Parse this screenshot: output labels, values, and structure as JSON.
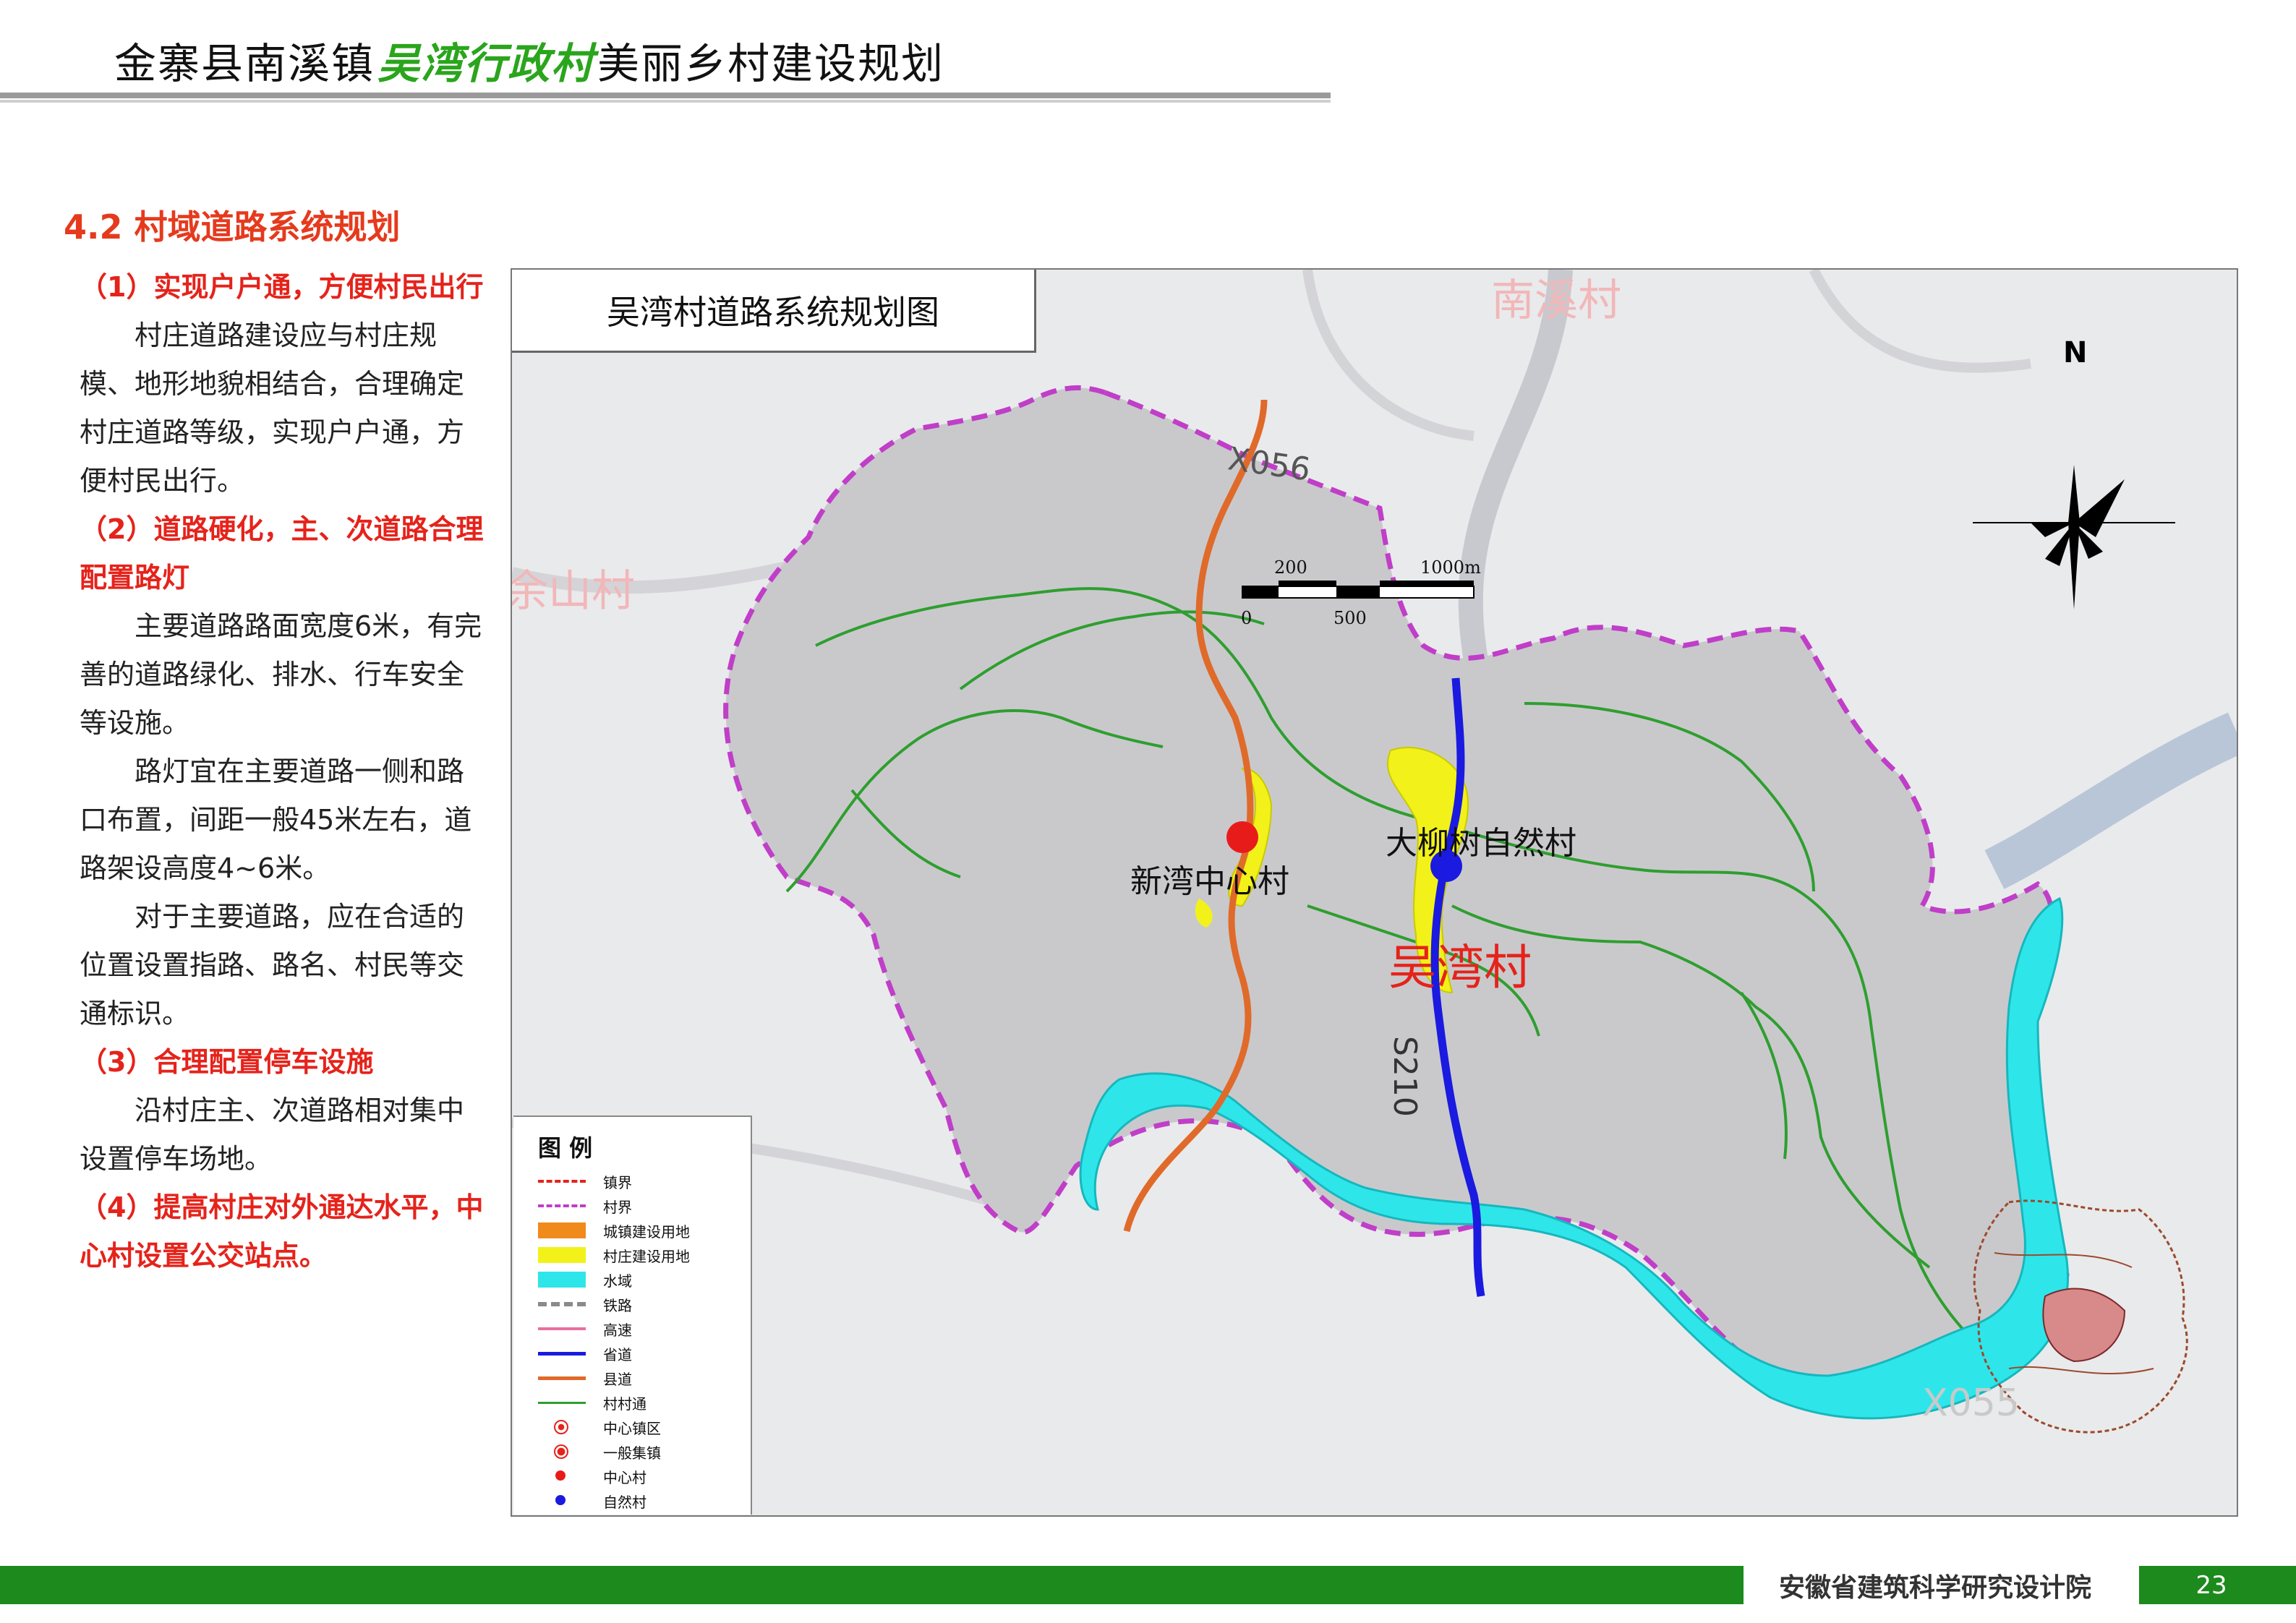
{
  "header": {
    "title_pre": "金寨县南溪镇",
    "title_highlight": "吴湾行政村",
    "title_post": "美丽乡村建设规划"
  },
  "section": {
    "title": "4.2 村域道路系统规划",
    "items": [
      {
        "heading": "（1）实现户户通，方便村民出行",
        "paragraphs": [
          "村庄道路建设应与村庄规模、地形地貌相结合，合理确定村庄道路等级，实现户户通，方便村民出行。"
        ]
      },
      {
        "heading": "（2）道路硬化，主、次道路合理配置路灯",
        "paragraphs": [
          "主要道路路面宽度6米，有完善的道路绿化、排水、行车安全等设施。",
          "路灯宜在主要道路一侧和路口布置，间距一般45米左右，道路架设高度4~6米。",
          "对于主要道路，应在合适的位置设置指路、路名、村民等交通标识。"
        ]
      },
      {
        "heading": "（3）合理配置停车设施",
        "paragraphs": [
          "沿村庄主、次道路相对集中设置停车场地。"
        ]
      },
      {
        "heading": "（4）提高村庄对外通达水平，中心村设置公交站点。",
        "paragraphs": []
      }
    ]
  },
  "map": {
    "title": "吴湾村道路系统规划图",
    "labels": {
      "center_village": "新湾中心村",
      "natural_village": "大柳树自然村",
      "main_village": "吴湾村",
      "neighbor_north": "南溪村",
      "neighbor_west": "余山村",
      "road_county": "X056",
      "road_county2": "X055",
      "road_provincial": "S210"
    },
    "compass": {
      "north": "N"
    },
    "scale": {
      "label_200": "200",
      "label_1000": "1000m",
      "label_0": "0",
      "label_500": "500"
    },
    "legend": {
      "title": "图 例",
      "items": [
        {
          "label": "镇界",
          "symbol": "town-boundary"
        },
        {
          "label": "村界",
          "symbol": "village-boundary"
        },
        {
          "label": "城镇建设用地",
          "symbol": "urban-land"
        },
        {
          "label": "村庄建设用地",
          "symbol": "village-land"
        },
        {
          "label": "水域",
          "symbol": "water"
        },
        {
          "label": "铁路",
          "symbol": "railway"
        },
        {
          "label": "高速",
          "symbol": "expressway"
        },
        {
          "label": "省道",
          "symbol": "provincial-road"
        },
        {
          "label": "县道",
          "symbol": "county-road"
        },
        {
          "label": "村村通",
          "symbol": "village-road"
        },
        {
          "label": "中心镇区",
          "symbol": "central-town"
        },
        {
          "label": "一般集镇",
          "symbol": "general-town"
        },
        {
          "label": "中心村",
          "symbol": "central-village"
        },
        {
          "label": "自然村",
          "symbol": "natural-village"
        }
      ]
    }
  },
  "colors": {
    "accent_red": "#e5231b",
    "highlight_green": "#2aa51c",
    "footer_green": "#1c8a1c",
    "water": "#2ee6ea",
    "village_land": "#f2f21a",
    "provincial_road": "#1a1ae0",
    "county_road": "#e06a2a",
    "village_road": "#2f9e2f",
    "boundary": "#c03ec8"
  },
  "footer": {
    "org": "安徽省建筑科学研究设计院",
    "page": "23"
  }
}
